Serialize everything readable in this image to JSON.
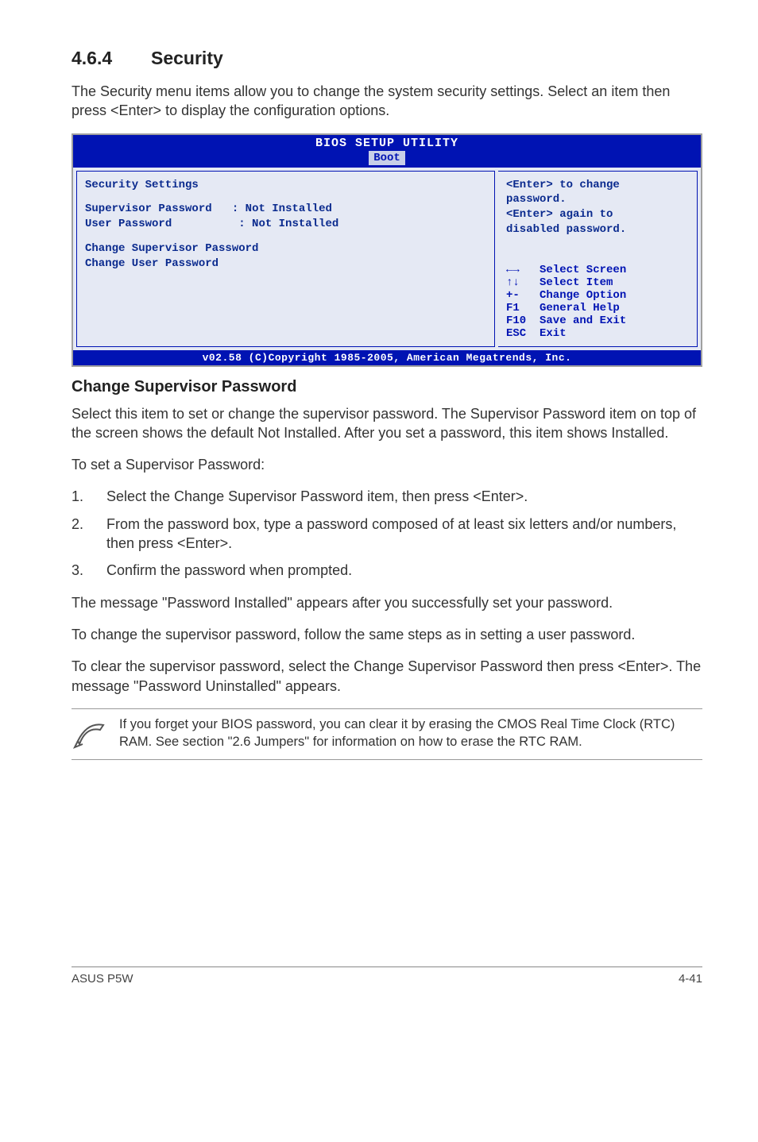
{
  "section": {
    "number": "4.6.4",
    "title": "Security"
  },
  "intro": "The Security menu items allow you to change the system security settings. Select an item then press <Enter> to display the configuration options.",
  "bios": {
    "title": "BIOS SETUP UTILITY",
    "tab": "Boot",
    "left": {
      "heading": "Security Settings",
      "row1_label": "Supervisor Password",
      "row1_value": ": Not Installed",
      "row2_label": "User Password",
      "row2_value": ": Not Installed",
      "item1": "Change Supervisor Password",
      "item2": "Change User Password"
    },
    "right": {
      "desc1": "<Enter> to change",
      "desc2": "password.",
      "desc3": "<Enter> again to",
      "desc4": "disabled password.",
      "help": [
        {
          "key": "←→",
          "label": "Select Screen"
        },
        {
          "key": "↑↓",
          "label": "Select Item"
        },
        {
          "key": "+-",
          "label": "Change Option"
        },
        {
          "key": "F1",
          "label": "General Help"
        },
        {
          "key": "F10",
          "label": "Save and Exit"
        },
        {
          "key": "ESC",
          "label": "Exit"
        }
      ]
    },
    "footer": "v02.58 (C)Copyright 1985-2005, American Megatrends, Inc."
  },
  "sub": {
    "heading": "Change Supervisor Password",
    "p1": "Select this item to set or change the supervisor password. The Supervisor Password item on top of the screen shows the default Not Installed. After you set a password, this item shows Installed.",
    "p2": "To set a Supervisor Password:",
    "steps": [
      "Select the Change Supervisor Password item, then press <Enter>.",
      "From the password box, type a password composed of at least six letters and/or numbers, then press <Enter>.",
      "Confirm the password when prompted."
    ],
    "p3": "The message \"Password Installed\" appears after you successfully set your password.",
    "p4": "To change the supervisor password, follow the same steps as in setting a user password.",
    "p5": "To clear the supervisor password, select the Change Supervisor Password then press <Enter>. The message \"Password Uninstalled\" appears."
  },
  "note": "If you forget your BIOS password, you can clear it by erasing the CMOS Real Time Clock (RTC) RAM. See section \"2.6  Jumpers\" for information on how to erase the RTC RAM.",
  "footer": {
    "left": "ASUS P5W",
    "right": "4-41"
  }
}
